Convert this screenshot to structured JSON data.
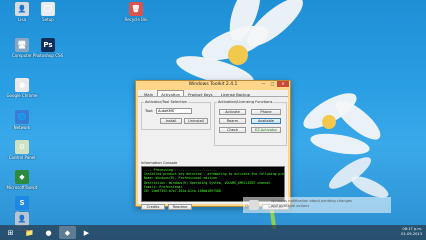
{
  "desktop_icons": [
    {
      "name": "desktop-icon-lisa",
      "label": "Lisa",
      "color": "#d6dbe0",
      "glyph": "👤"
    },
    {
      "name": "desktop-icon-2",
      "label": "Setup",
      "color": "#e7ecf2",
      "glyph": "🗔"
    },
    {
      "name": "desktop-icon-3",
      "label": "Recycle Bin",
      "color": "#d9534f",
      "glyph": "🗑"
    },
    {
      "name": "desktop-icon-computer",
      "label": "Computer",
      "color": "#8aa7c2",
      "glyph": "🖥"
    },
    {
      "name": "desktop-icon-photoshop",
      "label": "Photoshop CS6",
      "color": "#0d2d5a",
      "glyph": "Ps"
    },
    {
      "name": "desktop-icon-chrome",
      "label": "Google Chrome",
      "color": "#e9e9e9",
      "glyph": "●"
    },
    {
      "name": "desktop-icon-network",
      "label": "Network",
      "color": "#3a7bd5",
      "glyph": "🌐"
    },
    {
      "name": "desktop-icon-control",
      "label": "Control Panel",
      "color": "#cfe2c4",
      "glyph": "⚙"
    },
    {
      "name": "desktop-icon-toolkit",
      "label": "MicrosoftToolkit",
      "color": "#2d8a3e",
      "glyph": "◆"
    },
    {
      "name": "desktop-icon-skype",
      "label": "Skype",
      "color": "#1e88e5",
      "glyph": "S"
    },
    {
      "name": "desktop-icon-user",
      "label": "Lisa",
      "color": "#b8c4cf",
      "glyph": "👤"
    }
  ],
  "window": {
    "title": "Windows Toolkit 2.4.1",
    "minimize": "—",
    "maximize": "□",
    "close": "✕",
    "tabs": [
      "Main",
      "Activation",
      "Product Keys",
      "License Backup"
    ],
    "active_tab": "Activation",
    "activator_group": "Activator/Tool Selection",
    "tool_label": "Tool:",
    "tool_value": "AutoKMS",
    "install_btn": "Install",
    "uninstall_btn": "Uninstall",
    "licensing_group": "Activation/Licensing Functions",
    "activate_btn": "Activate",
    "phone_btn": "Phone",
    "rearm_btn": "Rearm",
    "available_btn": "Available",
    "check_btn": "Check",
    "ez_btn": "EZ-Activator",
    "console_label": "Information Console",
    "console_lines": [
      "---- Processing ----------------------",
      "",
      "Installed product key detected - attempting to activate the following product:",
      "Name: Windows(R), Professional edition",
      "Description: Windows(R) Operating System, VOLUME_KMSCLIENT channel",
      "Family: Professional",
      "ID: 2de67392-b7a7-462a-b1ca-108dd189f588"
    ],
    "credits_btn": "Credits",
    "readme_btn": "Readme",
    "settings_btn": "Settings"
  },
  "toast": {
    "text_1": "Windows notification about pending changes",
    "text_2": "and available actions"
  },
  "taskbar": {
    "items": [
      {
        "name": "start-button",
        "glyph": "⊞"
      },
      {
        "name": "taskbar-explorer",
        "glyph": "📁"
      },
      {
        "name": "taskbar-chrome",
        "glyph": "●"
      },
      {
        "name": "taskbar-toolkit",
        "glyph": "◆"
      },
      {
        "name": "taskbar-media",
        "glyph": "▶"
      }
    ],
    "time": "08:17 p.m.",
    "date": "01-09-2013"
  },
  "colors": {
    "console_text": "#4dff2e",
    "window_frame": "#ffd58a"
  }
}
